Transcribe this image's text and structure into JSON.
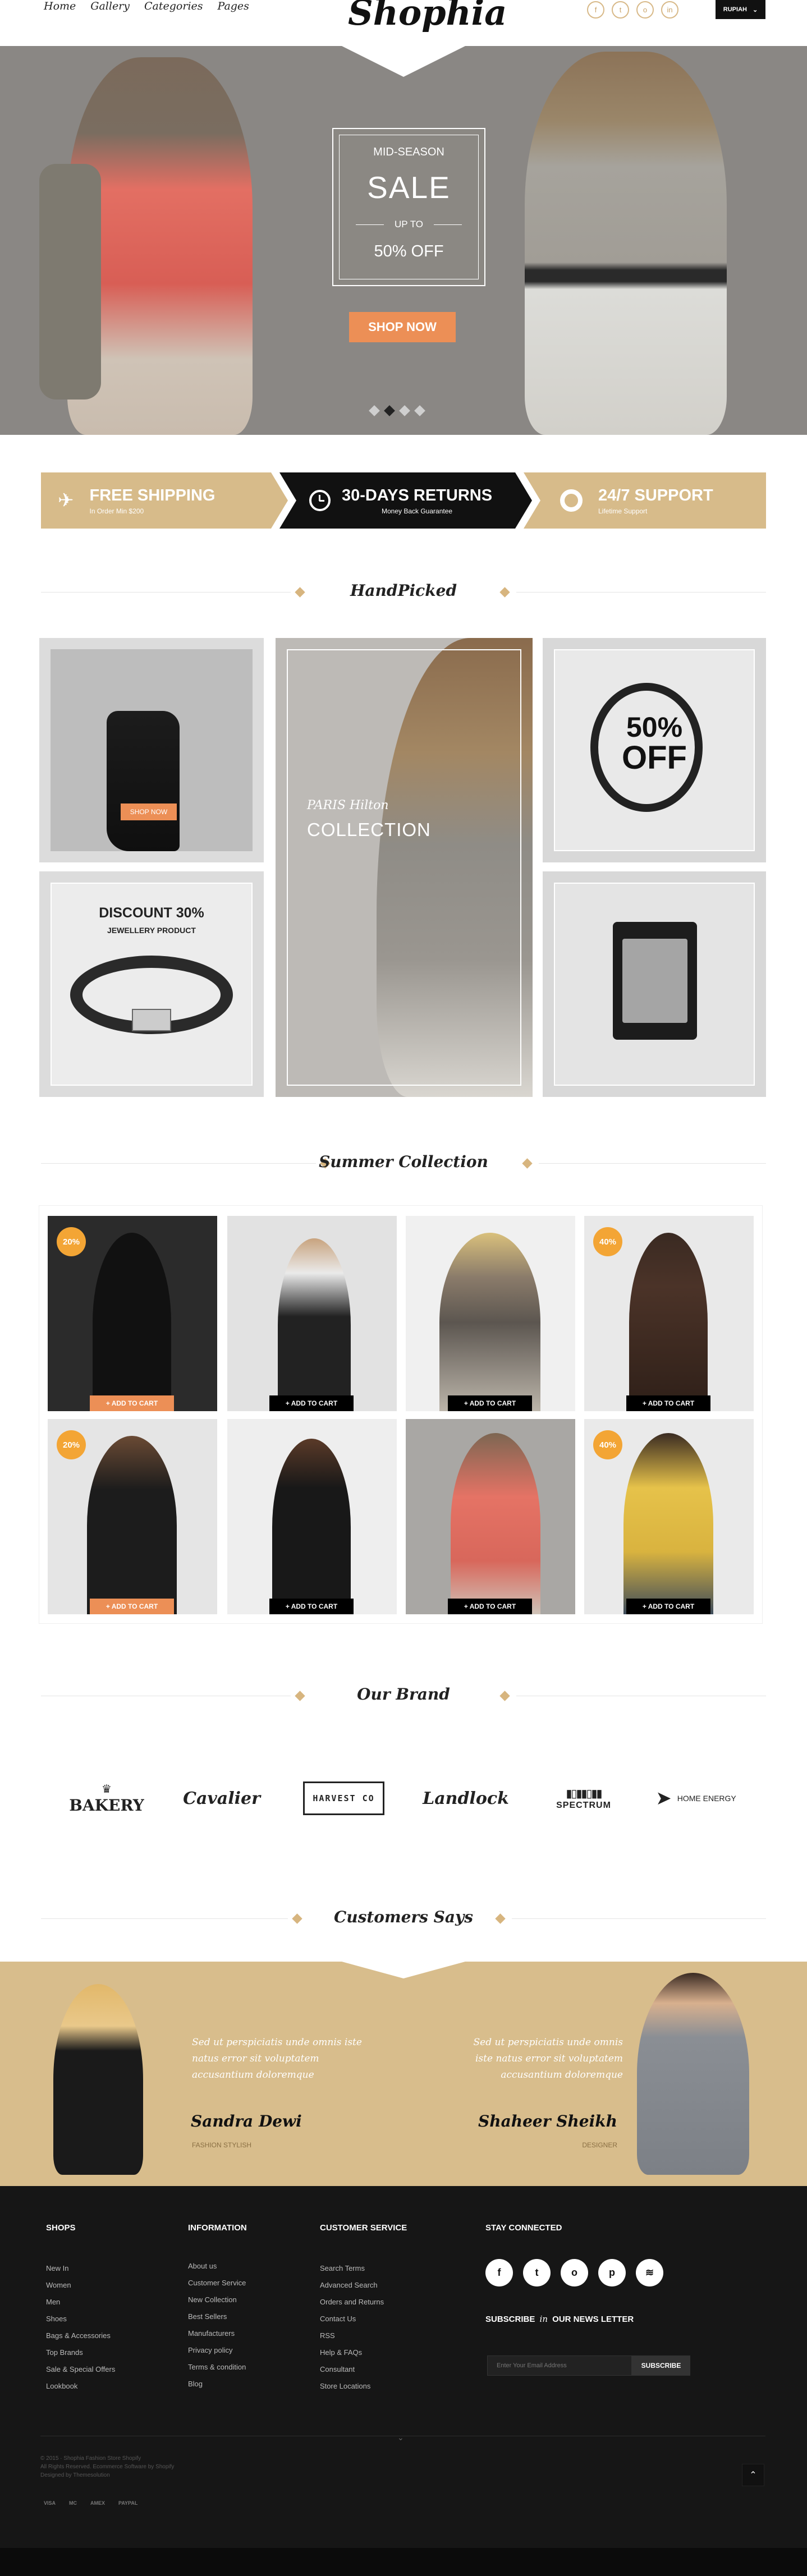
{
  "header": {
    "nav": [
      "Home",
      "Gallery",
      "Categories",
      "Pages"
    ],
    "logo": "Shophia",
    "socials": [
      "f",
      "t",
      "o",
      "in"
    ],
    "currency": "RUPIAH",
    "currency_caret": "⌄"
  },
  "hero": {
    "mid": "MID-SEASON",
    "sale": "SALE",
    "upto": "UP TO",
    "percent": "50%  OFF",
    "shop_now": "SHOP NOW",
    "slides": 4,
    "active_slide": 2
  },
  "features": [
    {
      "title": "FREE SHIPPING",
      "sub": "In Order Min $200",
      "icon": "plane-icon"
    },
    {
      "title": "30-DAYS RETURNS",
      "sub": "Money Back  Guarantee",
      "icon": "clock-icon"
    },
    {
      "title": "24/7 SUPPORT",
      "sub": "Lifetime Support",
      "icon": "lifebuoy-icon"
    }
  ],
  "handpicked": {
    "title": "HandPicked",
    "shop_now": "SHOP NOW",
    "paris": "PARIS Hilton",
    "collection": "COLLECTION",
    "fifty": "50%",
    "off": "OFF",
    "discount": "DISCOUNT 30%",
    "jewellery": "JEWELLERY PRODUCT"
  },
  "summer": {
    "title": "Summer Collection",
    "add_to_cart": "+ ADD TO CART",
    "badges": [
      "20%",
      "40%",
      "20%",
      "40%"
    ]
  },
  "brands": {
    "title": "Our Brand",
    "items": [
      "BAKERY",
      "Cavalier",
      "HARVEST CO",
      "Landlock",
      "SPECTRUM",
      "HOME ENERGY"
    ]
  },
  "testimonials": {
    "title": "Customers Says",
    "left": {
      "quote": "Sed ut perspiciatis unde omnis iste natus error sit voluptatem accusantium doloremque",
      "name": "Sandra Dewi",
      "role": "FASHION STYLISH"
    },
    "right": {
      "quote": "Sed ut perspiciatis unde omnis iste natus error sit voluptatem accusantium doloremque",
      "name": "Shaheer Sheikh",
      "role": "DESIGNER"
    }
  },
  "footer": {
    "shops": {
      "title": "SHOPS",
      "items": [
        "New In",
        "Women",
        "Men",
        "Shoes",
        "Bags & Accessories",
        "Top Brands",
        "Sale & Special Offers",
        "Lookbook"
      ]
    },
    "information": {
      "title": "INFORMATION",
      "items": [
        "About us",
        "Customer Service",
        "New Collection",
        "Best Sellers",
        "Manufacturers",
        "Privacy policy",
        "Terms & condition",
        "Blog"
      ]
    },
    "customer": {
      "title": "CUSTOMER SERVICE",
      "items": [
        "Search Terms",
        "Advanced Search",
        "Orders and Returns",
        "Contact Us",
        "RSS",
        "Help & FAQs",
        "Consultant",
        "Store Locations"
      ]
    },
    "stay": {
      "title": "STAY CONNECTED",
      "socials": [
        "f",
        "t",
        "o",
        "p",
        "≋"
      ]
    },
    "subscribe_pre": "SUBSCRIBE",
    "subscribe_in": "in",
    "subscribe_post": "OUR  NEWS LETTER",
    "email_placeholder": "Enter Your Email Address",
    "subscribe_btn": "SUBSCRIBE",
    "copyright": [
      "© 2015 · Shophia Fashion Store Shopify",
      "All Rights Reserved. Ecommerce Software by Shopify",
      "Designed by Themesolution"
    ],
    "payments": [
      "VISA",
      "MC",
      "AMEX",
      "PAYPAL"
    ],
    "scroll_top": "⌃"
  }
}
